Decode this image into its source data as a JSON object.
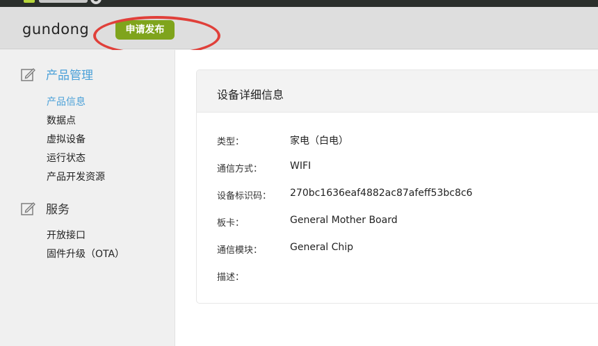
{
  "header": {
    "product_name": "gundong",
    "publish_label": "申请发布"
  },
  "sidebar": {
    "sections": [
      {
        "title": "产品管理",
        "icon": "edit-icon",
        "items": [
          "产品信息",
          "数据点",
          "虚拟设备",
          "运行状态",
          "产品开发资源"
        ]
      },
      {
        "title": "服务",
        "icon": "edit-icon",
        "items": [
          "开放接口",
          "固件升级（OTA）"
        ]
      }
    ],
    "active_item": "产品信息"
  },
  "card": {
    "title": "设备详细信息",
    "rows": [
      {
        "label": "类型：",
        "value": "家电（白电）"
      },
      {
        "label": "通信方式：",
        "value": "WIFI"
      },
      {
        "label": "设备标识码：",
        "value": "270bc1636eaf4882ac87afeff53bc8c6"
      },
      {
        "label": "板卡：",
        "value": "General Mother Board"
      },
      {
        "label": "通信模块：",
        "value": "General Chip"
      },
      {
        "label": "描述：",
        "value": ""
      }
    ]
  },
  "colors": {
    "accent_green": "#7fa41c",
    "highlight_red": "#e0403a",
    "active_blue": "#4aa0d8"
  }
}
